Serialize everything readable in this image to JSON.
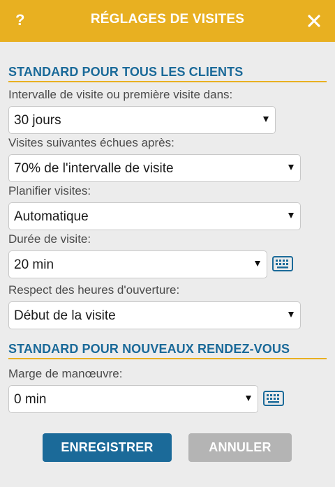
{
  "header": {
    "title": "RÉGLAGES DE VISITES",
    "help_label": "?",
    "close_icon": "close-icon",
    "color": "#e8b021"
  },
  "section_clients": {
    "title": "STANDARD POUR TOUS LES CLIENTS",
    "interval_label": "Intervalle de visite ou première visite dans:",
    "interval_value": "30 jours",
    "due_label": "Visites suivantes échues après:",
    "due_value": "70% de l'intervalle de visite",
    "plan_label": "Planifier visites:",
    "plan_value": "Automatique",
    "duration_label": "Durée de visite:",
    "duration_value": "20 min",
    "hours_label": "Respect des heures d'ouverture:",
    "hours_value": "Début de la visite"
  },
  "section_appointments": {
    "title": "STANDARD POUR NOUVEAUX RENDEZ-VOUS",
    "margin_label": "Marge de manœuvre:",
    "margin_value": "0 min"
  },
  "buttons": {
    "save_label": "ENREGISTRER",
    "cancel_label": "ANNULER"
  },
  "icons": {
    "keyboard": "keyboard-icon",
    "dropdown": "chevron-down-icon"
  },
  "colors": {
    "accent": "#e8b021",
    "primary": "#1b6a99",
    "disabled": "#b4b4b4"
  }
}
